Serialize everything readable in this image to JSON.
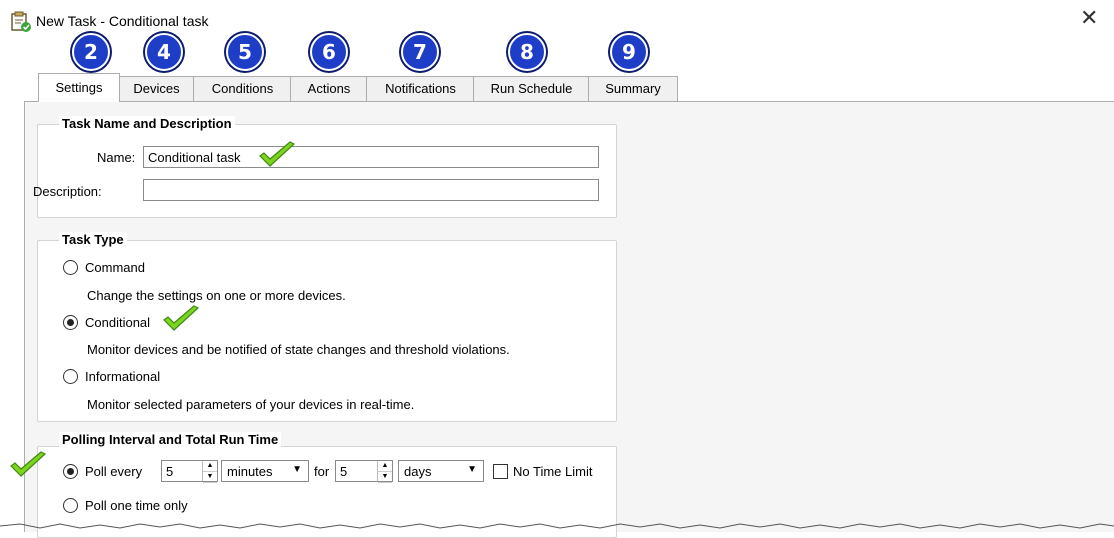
{
  "window": {
    "title": "New Task - Conditional task",
    "close_glyph": "✕",
    "icon": "task-icon"
  },
  "step_badges": [
    "2",
    "4",
    "5",
    "6",
    "7",
    "8",
    "9"
  ],
  "tabs": [
    {
      "label": "Settings",
      "active": true
    },
    {
      "label": "Devices"
    },
    {
      "label": "Conditions"
    },
    {
      "label": "Actions"
    },
    {
      "label": "Notifications"
    },
    {
      "label": "Run Schedule"
    },
    {
      "label": "Summary"
    }
  ],
  "name_desc": {
    "title": "Task Name and Description",
    "name_label": "Name:",
    "name_value": "Conditional task",
    "desc_label": "Description:",
    "desc_value": ""
  },
  "task_type": {
    "title": "Task Type",
    "options": [
      {
        "label": "Command",
        "desc": "Change the settings on one or more devices.",
        "selected": false
      },
      {
        "label": "Conditional",
        "desc": "Monitor devices and be notified of state changes and threshold violations.",
        "selected": true
      },
      {
        "label": "Informational",
        "desc": "Monitor selected parameters of your devices in real-time.",
        "selected": false
      }
    ]
  },
  "polling": {
    "title": "Polling Interval and Total Run Time",
    "poll_every_label": "Poll every",
    "interval_value": "5",
    "interval_unit": "minutes",
    "for_label": "for",
    "duration_value": "5",
    "duration_unit": "days",
    "no_time_limit_label": "No Time Limit",
    "no_time_limit_checked": false,
    "one_time_label": "Poll one time only",
    "poll_every_selected": true
  },
  "colors": {
    "badge": "#1f3ec8",
    "check": "#7ed321",
    "tab_border": "#adadad"
  }
}
